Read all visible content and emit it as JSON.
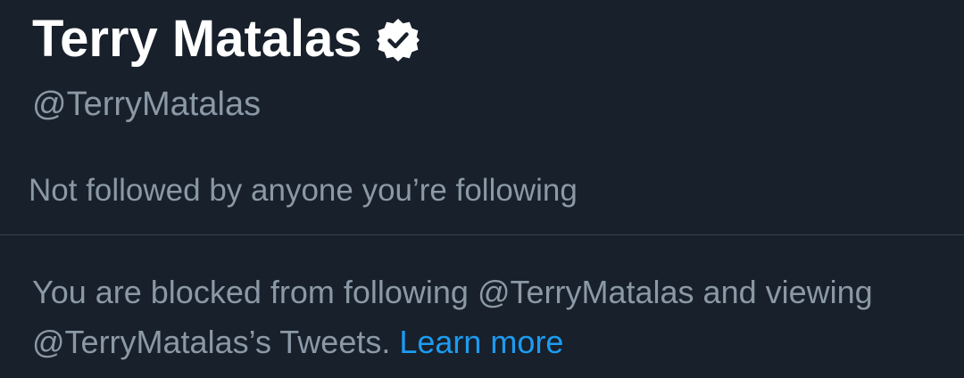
{
  "profile": {
    "display_name": "Terry Matalas",
    "verified": true,
    "badge_icon": "verified-badge-icon",
    "handle": "@TerryMatalas"
  },
  "social_context": {
    "followers_you_know": "Not followed by anyone you’re following"
  },
  "blocked_notice": {
    "message": "You are blocked from following @TerryMatalas and viewing @TerryMatalas’s Tweets.",
    "link_label": "Learn more"
  },
  "colors": {
    "background": "#17202b",
    "primary_text": "#ffffff",
    "secondary_text": "#8b98a5",
    "divider": "#38444d",
    "link": "#1d9bf0"
  }
}
